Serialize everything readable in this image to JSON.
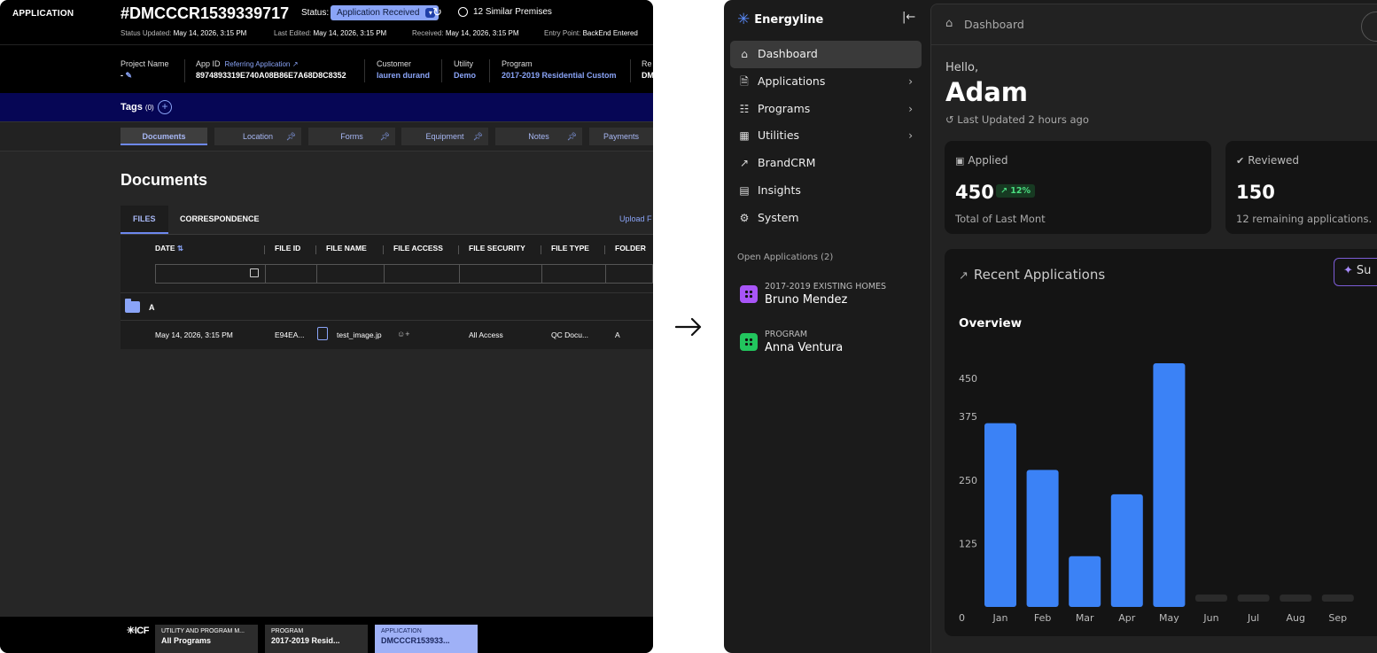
{
  "left_app": {
    "section_label": "APPLICATION",
    "app_number": "#DMCCCR1539339717",
    "status_label": "Status:",
    "status_value": "Application Received",
    "similar": "12 Similar Premises",
    "meta": [
      {
        "k": "Status Updated:",
        "v": "May 14, 2026, 3:15 PM"
      },
      {
        "k": "Last Edited:",
        "v": "May 14, 2026, 3:15 PM"
      },
      {
        "k": "Received:",
        "v": "May 14, 2026, 3:15 PM"
      },
      {
        "k": "Entry Point:",
        "v": "BackEnd Entered"
      }
    ],
    "fields": {
      "project_name_label": "Project Name",
      "project_name_value": "-",
      "app_id_label": "App ID",
      "referring_link": "Referring Application",
      "app_id_value": "8974893319E740A08B86E7A68D8C8352",
      "customer_label": "Customer",
      "customer_value": "lauren durand",
      "utility_label": "Utility",
      "utility_value": "Demo",
      "program_label": "Program",
      "program_value": "2017-2019 Residential Custom",
      "cut_label": "Re",
      "cut_value": "DM"
    },
    "tags_label": "Tags",
    "tags_count": "(0)",
    "tabs": [
      "Documents",
      "Location",
      "Forms",
      "Equipment",
      "Notes",
      "Payments"
    ],
    "docs_title": "Documents",
    "subtabs": [
      "FILES",
      "CORRESPONDENCE"
    ],
    "upload_label": "Upload F",
    "columns": [
      "DATE",
      "FILE ID",
      "FILE NAME",
      "FILE ACCESS",
      "FILE SECURITY",
      "FILE TYPE",
      "FOLDER"
    ],
    "group_label": "A",
    "row": {
      "date": "May 14, 2026, 3:15 PM",
      "file_id": "E94EA...",
      "file_name": "test_image.jp",
      "file_security": "All Access",
      "file_type": "QC Docu...",
      "folder": "A"
    },
    "footer": {
      "logo": "ICF",
      "crumbs": [
        {
          "t": "UTILITY AND PROGRAM M...",
          "v": "All Programs"
        },
        {
          "t": "PROGRAM",
          "v": "2017-2019 Resid..."
        },
        {
          "t": "APPLICATION",
          "v": "DMCCCR153933..."
        }
      ]
    }
  },
  "right_app": {
    "brand": "Energyline",
    "nav": [
      {
        "label": "Dashboard",
        "icon": "home-icon",
        "chevron": false
      },
      {
        "label": "Applications",
        "icon": "document-icon",
        "chevron": true
      },
      {
        "label": "Programs",
        "icon": "grid-icon",
        "chevron": true
      },
      {
        "label": "Utilities",
        "icon": "building-icon",
        "chevron": true
      },
      {
        "label": "BrandCRM",
        "icon": "trend-icon",
        "chevron": false
      },
      {
        "label": "Insights",
        "icon": "report-icon",
        "chevron": false
      },
      {
        "label": "System",
        "icon": "gears-icon",
        "chevron": false
      }
    ],
    "open_apps_label": "Open Applications (2)",
    "open_apps": [
      {
        "type": "2017-2019 EXISTING HOMES",
        "name": "Bruno Mendez",
        "color": "#a855f7"
      },
      {
        "type": "PROGRAM",
        "name": "Anna Ventura",
        "color": "#22c55e"
      }
    ],
    "breadcrumb": "Dashboard",
    "hello": "Hello,",
    "user_name": "Adam",
    "last_updated": "Last Updated 2 hours ago",
    "cards": [
      {
        "title": "Applied",
        "value": "450",
        "badge": "12%",
        "sub": "Total of Last Mont"
      },
      {
        "title": "Reviewed",
        "value": "150",
        "badge": "",
        "sub": "12 remaining applications."
      }
    ],
    "recent_title": "Recent Applications",
    "summary_button": "Su",
    "overview_title": "Overview"
  },
  "chart_data": {
    "type": "bar",
    "title": "Overview",
    "categories": [
      "Jan",
      "Feb",
      "Mar",
      "Apr",
      "May",
      "Jun",
      "Jul",
      "Aug",
      "Sep"
    ],
    "values": [
      362,
      270,
      100,
      222,
      480,
      0,
      0,
      0,
      0
    ],
    "yticks": [
      0,
      125,
      250,
      375,
      450
    ],
    "ylim": [
      0,
      480
    ],
    "bar_color": "#3b82f6",
    "empty_color": "#2b2b2b"
  }
}
